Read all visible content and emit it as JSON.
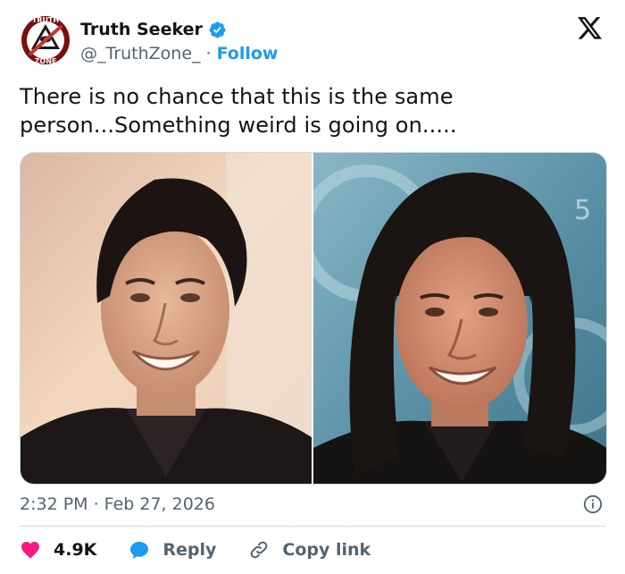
{
  "author": {
    "display_name": "Truth Seeker",
    "handle": "@_TruthZone_",
    "separator": "·",
    "follow_label": "Follow",
    "avatar_text_top": "TRUTH",
    "avatar_text_bottom": "ZONE",
    "verified_color": "#1d9bf0"
  },
  "tweet": {
    "text": "There is no chance that this is the same person...Something weird is going on.....",
    "timestamp": "2:32 PM · Feb 27, 2026"
  },
  "media": {
    "left_image": "portrait-photo-short-dark-hair",
    "right_image": "portrait-photo-long-dark-hair"
  },
  "actions": {
    "likes_count": "4.9K",
    "reply_label": "Reply",
    "copy_link_label": "Copy link"
  },
  "colors": {
    "accent": "#1d9bf0",
    "like": "#f91880",
    "secondary_text": "#536471",
    "border": "#cfd9de"
  },
  "icons": {
    "platform": "x-logo-icon",
    "verified": "verified-badge-icon",
    "info": "info-icon",
    "like": "heart-icon",
    "reply": "speech-bubble-icon",
    "copy": "link-icon"
  }
}
